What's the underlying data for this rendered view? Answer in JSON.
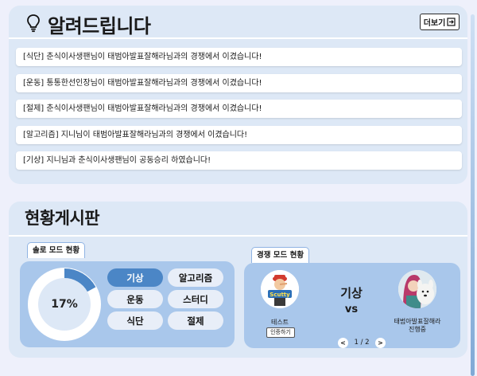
{
  "notice": {
    "title": "알려드립니다",
    "more_label": "더보기",
    "icons": {
      "title": "lightbulb-icon",
      "more": "exit-arrow-icon"
    },
    "items": [
      "[식단] 춘식이사생팬님이 태범아발표잘해라님과의 경쟁에서 이겼습니다!",
      "[운동] 통통한선인장님이 태범아발표잘해라님과의 경쟁에서 이겼습니다!",
      "[절제] 춘식이사생팬님이 태범아발표잘해라님과의 경쟁에서 이겼습니다!",
      "[알고리즘] 지니님이 태범아발표잘해라님과의 경쟁에서 이겼습니다!",
      "[기상] 지니님과 춘식이사생팬님이 공동승리 하였습니다!"
    ]
  },
  "board": {
    "title": "현황게시판",
    "solo": {
      "tab_label": "솔로 모드 현황",
      "progress_label": "17%",
      "progress_value": 0.17,
      "categories": [
        {
          "label": "기상",
          "active": true
        },
        {
          "label": "알고리즘",
          "active": false
        },
        {
          "label": "운동",
          "active": false
        },
        {
          "label": "스터디",
          "active": false
        },
        {
          "label": "식단",
          "active": false
        },
        {
          "label": "절제",
          "active": false
        }
      ]
    },
    "competition": {
      "tab_label": "경쟁 모드 현황",
      "category": "기상",
      "vs_label": "vs",
      "left": {
        "name": "테스트",
        "button_label": "인증하기",
        "avatar": "pinocchio-avatar",
        "avatar_text": "Scutty"
      },
      "right": {
        "name": "태범아발표잘해라",
        "status": "진행중",
        "avatar": "girl-with-dog-avatar"
      },
      "pager": {
        "prev": "<",
        "text": "1 / 2",
        "next": ">"
      }
    }
  },
  "colors": {
    "page_bg": "#eef0fb",
    "panel_bg": "#dde8f6",
    "card_bg": "#a9c7eb",
    "accent": "#4b86c6",
    "chip_bg": "#e8eef8"
  }
}
